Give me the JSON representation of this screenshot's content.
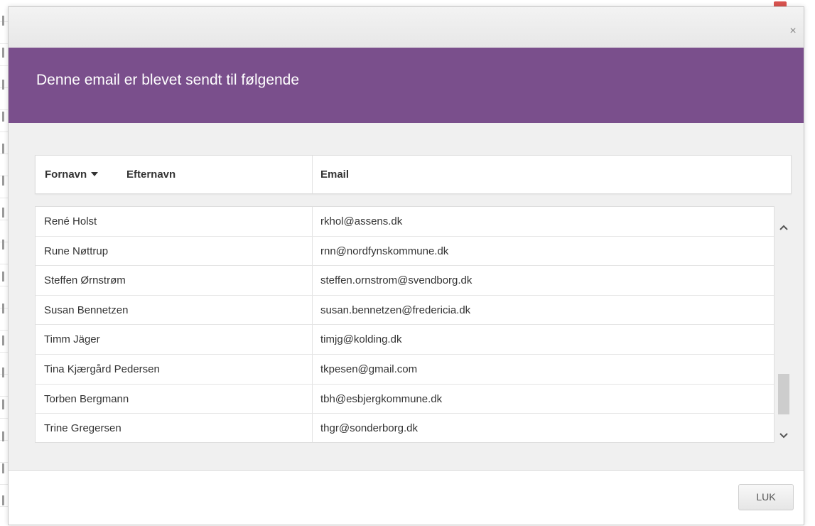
{
  "dialog": {
    "title": "Denne email er blevet sendt til følgende",
    "close_label": "×",
    "close_button_label": "LUK"
  },
  "table": {
    "columns": {
      "first_name": "Fornavn",
      "last_name": "Efternavn",
      "email": "Email"
    },
    "sorted_by": "Fornavn",
    "rows": [
      {
        "name": "René Holst",
        "email": "rkhol@assens.dk"
      },
      {
        "name": "Rune Nøttrup",
        "email": "rnn@nordfynskommune.dk"
      },
      {
        "name": "Steffen Ørnstrøm",
        "email": "steffen.ornstrom@svendborg.dk"
      },
      {
        "name": "Susan Bennetzen",
        "email": "susan.bennetzen@fredericia.dk"
      },
      {
        "name": "Timm Jäger",
        "email": "timjg@kolding.dk"
      },
      {
        "name": "Tina Kjærgård Pedersen",
        "email": "tkpesen@gmail.com"
      },
      {
        "name": "Torben Bergmann",
        "email": "tbh@esbjergkommune.dk"
      },
      {
        "name": "Trine Gregersen",
        "email": "thgr@sonderborg.dk"
      }
    ]
  },
  "colors": {
    "header": "#7a4f8c",
    "body_bg": "#f0f0f0"
  },
  "icons": {
    "close": "close-icon",
    "sort": "sort-desc-caret-icon",
    "scroll_up": "chevron-up-icon",
    "scroll_down": "chevron-down-icon"
  }
}
